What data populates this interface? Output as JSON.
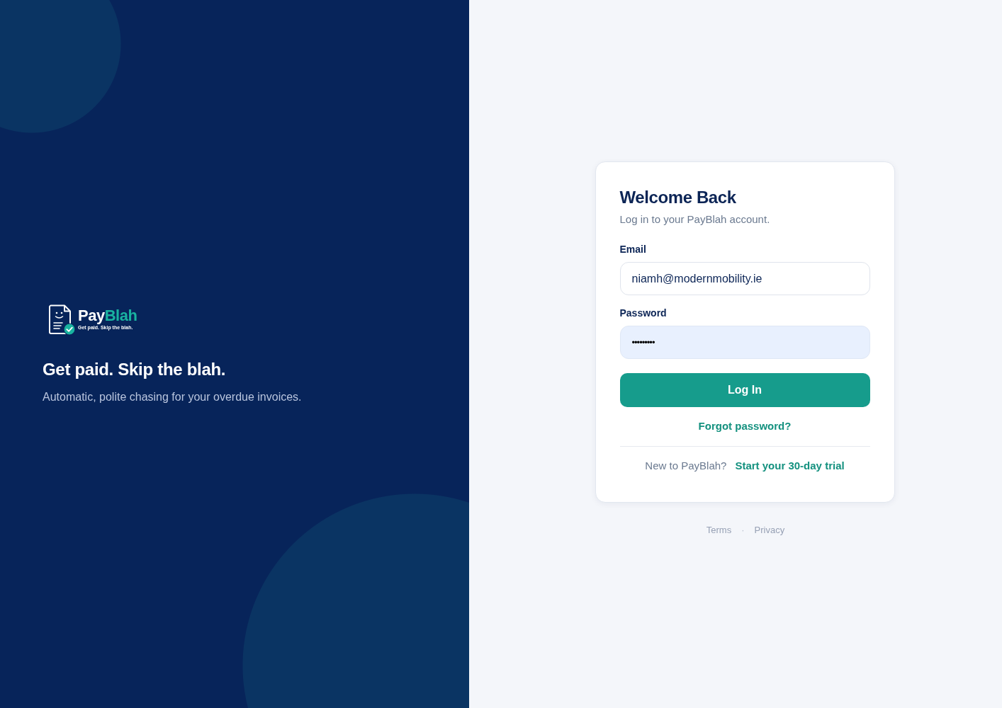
{
  "brand": {
    "wordmark_first": "Pay",
    "wordmark_second": "Blah",
    "tagline": "Get paid. Skip the blah."
  },
  "hero": {
    "headline": "Get paid. Skip the blah.",
    "subtitle": "Automatic, polite chasing for your overdue invoices."
  },
  "login_card": {
    "title": "Welcome Back",
    "subtitle": "Log in to your PayBlah account.",
    "fields": [
      {
        "label": "Email",
        "value": "niamh@modernmobility.ie",
        "kind": "email",
        "autofilled": false
      },
      {
        "label": "Password",
        "value": "•••••••••",
        "kind": "password",
        "autofilled": true
      }
    ],
    "submit_button": "Log In",
    "forgot_link": "Forgot password?",
    "signup_prompt": "New to PayBlah?",
    "signup_link": "Start your 30-day trial"
  },
  "footer": {
    "links": [
      "Terms",
      "Privacy"
    ],
    "separator": "·"
  }
}
